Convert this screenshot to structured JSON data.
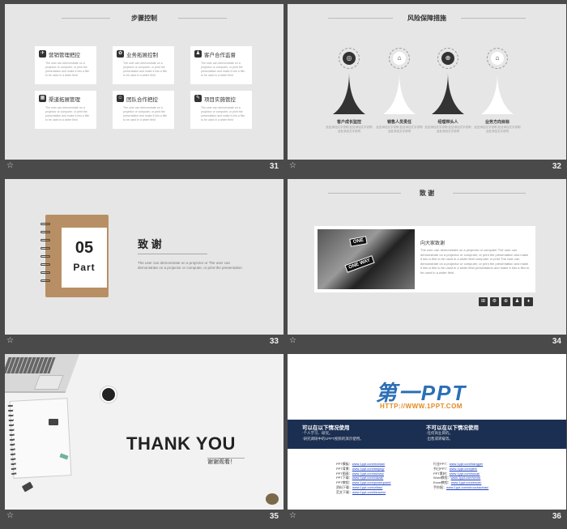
{
  "slides": [
    {
      "number": "31",
      "title": "步骤控制",
      "cards": [
        {
          "icon": "✈",
          "title": "营销管理把控",
          "body": "The user can demonstrate on a projector or computer, or print the presentation and make it into a film to be used in a wider field"
        },
        {
          "icon": "✿",
          "title": "业务拓展控制",
          "body": "The user can demonstrate on a projector or computer, or print the presentation and make it into a film to be used in a wider field"
        },
        {
          "icon": "♟",
          "title": "客户合作监督",
          "body": "The user can demonstrate on a projector or computer, or print the presentation and make it into a film to be used in a wider field"
        },
        {
          "icon": "▦",
          "title": "渠道拓展管理",
          "body": "The user can demonstrate on a projector or computer, or print the presentation and make it into a film to be used in a wider field"
        },
        {
          "icon": "☺",
          "title": "团队合作把控",
          "body": "The user can demonstrate on a projector or computer, or print the presentation and make it into a film to be used in a wider field"
        },
        {
          "icon": "✎",
          "title": "项目实施管控",
          "body": "The user can demonstrate on a projector or computer, or print the presentation and make it into a film to be used in a wider field"
        }
      ]
    },
    {
      "number": "32",
      "title": "风险保障措施",
      "items": [
        {
          "icon": "◎",
          "label": "客户成长监控",
          "body": "此处添加文字说明 此处添加文字说明 此处添加文字说明"
        },
        {
          "icon": "⌂",
          "label": "销售人员责任",
          "body": "此处添加文字说明 此处添加文字说明 此处添加文字说明"
        },
        {
          "icon": "⊕",
          "label": "经理带头人",
          "body": "此处添加文字说明 此处添加文字说明 此处添加文字说明"
        },
        {
          "icon": "⌂",
          "label": "业务方向目标",
          "body": "此处添加文字说明 此处添加文字说明 此处添加文字说明"
        }
      ]
    },
    {
      "number": "33",
      "part_num": "05",
      "part_label": "Part",
      "heading": "致 谢",
      "body": "The user can demonstrate on a projector or The user can demonstrate on a projector or computer, or print the presentation"
    },
    {
      "number": "34",
      "title": "致 谢",
      "sign1": "ONE",
      "sign2": "ONE WAY",
      "subtitle": "向大家致谢",
      "body": "The user can demonstrate on a projector or computer The user can demonstrate on a projector or computer, or print the presentation and make it into a film to be used in a wider field computer or print The user can demonstrate on a projector or computer, or print the presentation and make it into a film to be used in a wider field presentation and make it into a film to be used in a wider field",
      "icons": [
        "⊞",
        "⚙",
        "⊕",
        "♟",
        "♦"
      ]
    },
    {
      "number": "35",
      "title": "THANK YOU",
      "subtitle": "谢谢观看！"
    },
    {
      "number": "36",
      "logo": "第一PPT",
      "url": "HTTP://WWW.1PPT.COM",
      "left_head": "可以在以下情况使用",
      "left_lines": [
        "·个人学习、研究。",
        "·研究调研中的1PPT视频的演示使用。"
      ],
      "right_head": "不可以在以下情况使用",
      "right_lines": [
        "·任何商业目的。",
        "·出售或转载等。"
      ],
      "links_left": [
        {
          "label": "PPT模板：",
          "url": "www.1ppt.com/moban/"
        },
        {
          "label": "PPT背景：",
          "url": "www.1ppt.com/beijing/"
        },
        {
          "label": "PPT图表：",
          "url": "www.1ppt.com/tubiao/"
        },
        {
          "label": "PPT下载：",
          "url": "www.1ppt.com/xiazai/"
        },
        {
          "label": "PPT教程：",
          "url": "www.1ppt.com/powerpoint/"
        },
        {
          "label": "资料下载：",
          "url": "www.1ppt.com/ziliao/"
        },
        {
          "label": "范文下载：",
          "url": "www.1ppt.com/fanwen/"
        }
      ],
      "links_right": [
        {
          "label": "行业PPT：",
          "url": "www.1ppt.com/hangye/"
        },
        {
          "label": "节日PPT：",
          "url": "www.1ppt.com/jieri/"
        },
        {
          "label": "PPT素材：",
          "url": "www.1ppt.com/sucai/"
        },
        {
          "label": "Word教程：",
          "url": "www.1ppt.com/word/"
        },
        {
          "label": "Excel教程：",
          "url": "www.1ppt.com/excel/"
        },
        {
          "label": "手抄报：",
          "url": "www.1ppt.com/shouchaobao/"
        }
      ]
    }
  ]
}
